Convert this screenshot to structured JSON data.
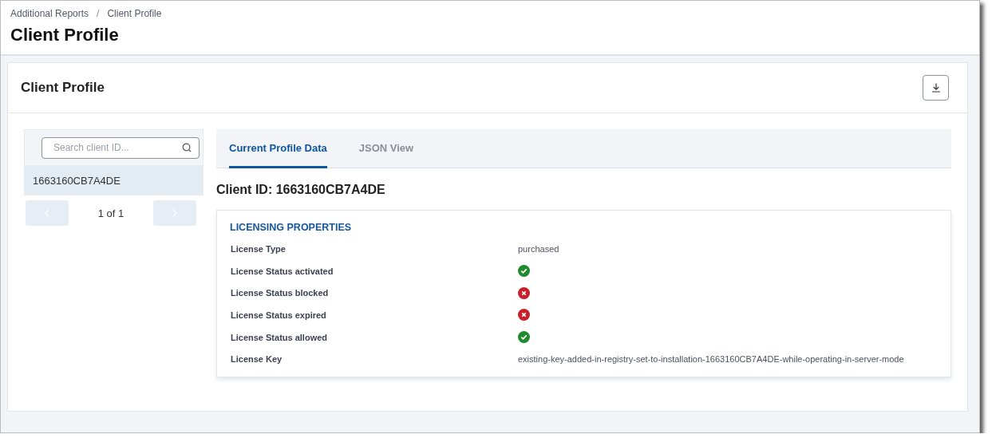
{
  "breadcrumb": {
    "items": [
      "Additional Reports",
      "Client Profile"
    ],
    "separator": "/"
  },
  "page_title": "Client Profile",
  "card": {
    "title": "Client Profile"
  },
  "client_list": {
    "search": {
      "placeholder": "Search client ID..."
    },
    "items": [
      {
        "label": "1663160CB7A4DE",
        "selected": true
      }
    ],
    "pagination": {
      "text": "1 of 1",
      "prev_disabled": true,
      "next_disabled": true
    }
  },
  "tabs": [
    {
      "label": "Current Profile Data",
      "selected": true
    },
    {
      "label": "JSON View",
      "selected": false
    }
  ],
  "client_id_heading": "Client ID: 1663160CB7A4DE",
  "properties": {
    "title": "LICENSING PROPERTIES",
    "rows": [
      {
        "kind": "text",
        "label": "License Type",
        "value": "purchased"
      },
      {
        "kind": "status",
        "label": "License Status activated",
        "ok": true
      },
      {
        "kind": "status",
        "label": "License Status blocked",
        "ok": false
      },
      {
        "kind": "status",
        "label": "License Status expired",
        "ok": false
      },
      {
        "kind": "status",
        "label": "License Status allowed",
        "ok": true
      },
      {
        "kind": "text",
        "label": "License Key",
        "value": "existing-key-added-in-registry-set-to-installation-1663160CB7A4DE-while-operating-in-server-mode"
      }
    ]
  }
}
